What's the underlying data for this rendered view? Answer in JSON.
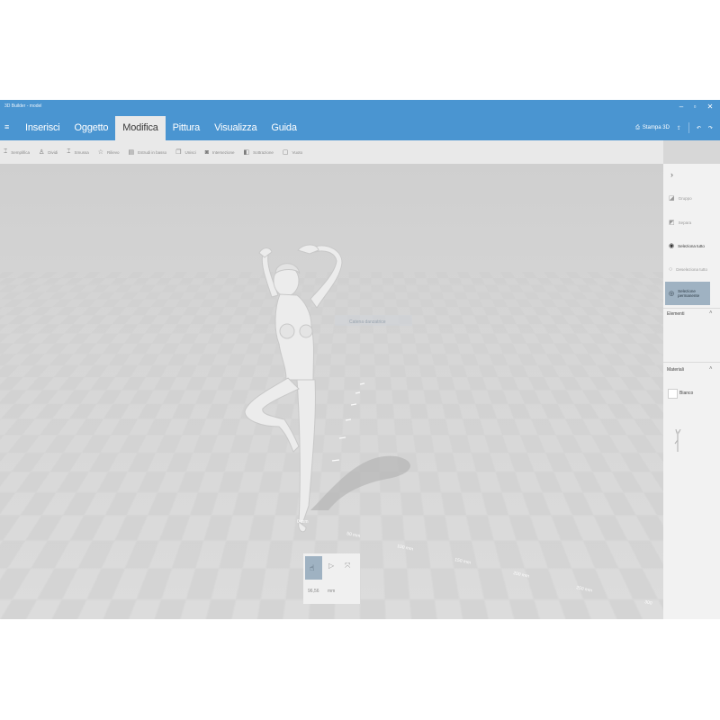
{
  "window": {
    "title": "3D Builder - model",
    "minimize": "–",
    "restore": "▫",
    "close": "✕"
  },
  "tabs": [
    {
      "label": "Inserisci",
      "active": false
    },
    {
      "label": "Oggetto",
      "active": false
    },
    {
      "label": "Modifica",
      "active": true
    },
    {
      "label": "Pittura",
      "active": false
    },
    {
      "label": "Visualizza",
      "active": false
    },
    {
      "label": "Guida",
      "active": false
    }
  ],
  "right_tools": {
    "print_label": "Stampa 3D",
    "undo_icon": "undo-icon",
    "redo_icon": "redo-icon"
  },
  "toolbar": [
    {
      "label": "Semplifica",
      "icon": "simplify-icon"
    },
    {
      "label": "Dividi",
      "icon": "split-icon"
    },
    {
      "label": "Smussa",
      "icon": "smooth-icon"
    },
    {
      "label": "Rilievo",
      "icon": "emboss-icon"
    },
    {
      "label": "Estrudi in basso",
      "icon": "extrude-icon"
    },
    {
      "label": "Unisci",
      "icon": "merge-icon"
    },
    {
      "label": "Intersezione",
      "icon": "intersect-icon"
    },
    {
      "label": "Sottrazione",
      "icon": "subtract-icon"
    },
    {
      "label": "Vuoto",
      "icon": "hollow-icon"
    }
  ],
  "viewport": {
    "tooltip": "Catena danzatrice",
    "ruler_labels": [
      "0 mm",
      "50 mm",
      "100 mm",
      "150 mm",
      "200 mm",
      "250 mm",
      "300"
    ]
  },
  "bottom_box": {
    "value": "96,56",
    "unit": "mm"
  },
  "panel": {
    "buttons": [
      {
        "label": "Gruppo",
        "style": "muted"
      },
      {
        "label": "Separa",
        "style": "muted"
      },
      {
        "label": "Seleziona tutto",
        "style": "dark"
      },
      {
        "label": "Deseleziona tutto",
        "style": "muted"
      },
      {
        "label": "Selezione permanente",
        "style": "selected"
      }
    ],
    "elements_heading": "Elementi",
    "materials_heading": "Materiali",
    "material_name": "Bianco",
    "accent": "#4a95d1",
    "selected_bg": "#9fb2c2"
  }
}
